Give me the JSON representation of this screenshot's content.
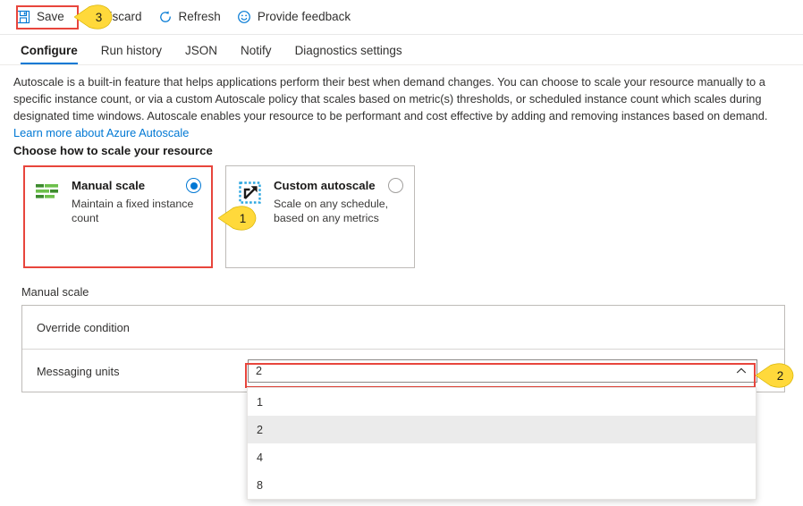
{
  "commandbar": {
    "items": [
      {
        "label": "Save",
        "icon": "save-icon"
      },
      {
        "label": "Discard",
        "icon": "discard-icon"
      },
      {
        "label": "Refresh",
        "icon": "refresh-icon"
      },
      {
        "label": "Provide feedback",
        "icon": "smiley-icon"
      }
    ]
  },
  "tabs": [
    {
      "label": "Configure",
      "active": true
    },
    {
      "label": "Run history",
      "active": false
    },
    {
      "label": "JSON",
      "active": false
    },
    {
      "label": "Notify",
      "active": false
    },
    {
      "label": "Diagnostics settings",
      "active": false
    }
  ],
  "description": {
    "text": "Autoscale is a built-in feature that helps applications perform their best when demand changes. You can choose to scale your resource manually to a specific instance count, or via a custom Autoscale policy that scales based on metric(s) thresholds, or scheduled instance count which scales during designated time windows. Autoscale enables your resource to be performant and cost effective by adding and removing instances based on demand. ",
    "link_text": "Learn more about Azure Autoscale"
  },
  "section": {
    "heading": "Choose how to scale your resource",
    "cards": [
      {
        "title": "Manual scale",
        "desc": "Maintain a fixed instance count",
        "icon": "manual-scale-icon",
        "selected": true
      },
      {
        "title": "Custom autoscale",
        "desc": "Scale on any schedule, based on any metrics",
        "icon": "custom-autoscale-icon",
        "selected": false
      }
    ]
  },
  "manual_scale": {
    "panel_label": "Manual scale",
    "override_condition_label": "Override condition",
    "messaging_units_label": "Messaging units",
    "messaging_units_value": "2",
    "chevron": "chevron-up-icon",
    "options": [
      "1",
      "2",
      "4",
      "8"
    ],
    "selected_option": "2"
  },
  "callouts": [
    {
      "number": "1"
    },
    {
      "number": "2"
    },
    {
      "number": "3"
    }
  ],
  "colors": {
    "accent": "#0078d4",
    "annotation": "#e8453c",
    "callout_fill": "#ffd93b",
    "manual_icon_green": "#51a33d"
  }
}
